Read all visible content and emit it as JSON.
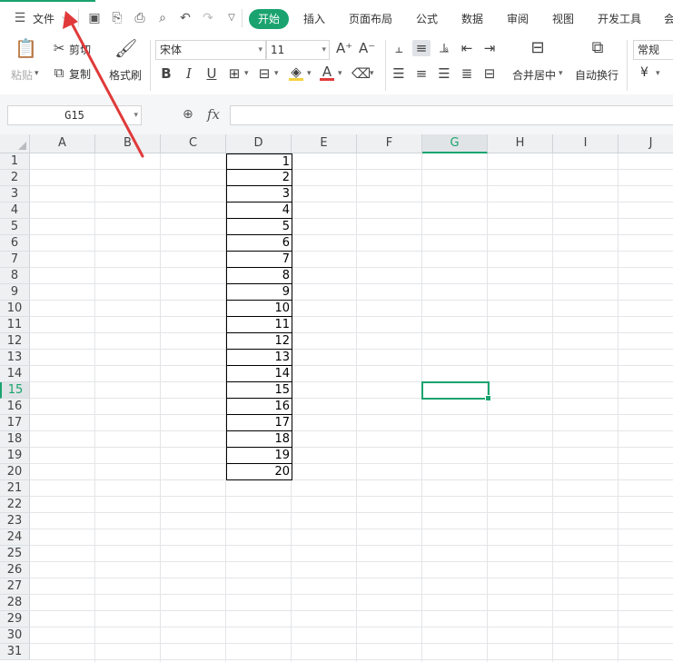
{
  "menubar": {
    "file_menu": "文件",
    "active_tab": "开始",
    "tabs": [
      "插入",
      "页面布局",
      "公式",
      "数据",
      "审阅",
      "视图",
      "开发工具",
      "会"
    ]
  },
  "ribbon": {
    "paste": "粘贴",
    "cut": "剪切",
    "copy": "复制",
    "format_painter": "格式刷",
    "font_name": "宋体",
    "font_size": "11",
    "merge_center": "合并居中",
    "wrap_text": "自动换行",
    "number_format": "常规",
    "currency_symbol": "¥"
  },
  "formula_bar": {
    "name_box": "G15",
    "fx_label": "fx",
    "formula": ""
  },
  "sheet": {
    "columns": [
      "A",
      "B",
      "C",
      "D",
      "E",
      "F",
      "G",
      "H",
      "I",
      "J"
    ],
    "selected_column": "G",
    "rows": [
      "1",
      "2",
      "3",
      "4",
      "5",
      "6",
      "7",
      "8",
      "9",
      "10",
      "11",
      "12",
      "13",
      "14",
      "15",
      "16",
      "17",
      "18",
      "19",
      "20",
      "21",
      "22",
      "23",
      "24",
      "25",
      "26",
      "27",
      "28",
      "29",
      "30",
      "31"
    ],
    "selected_row": "15",
    "selected_cell": "G15",
    "column_d_values": [
      "1",
      "2",
      "3",
      "4",
      "5",
      "6",
      "7",
      "8",
      "9",
      "10",
      "11",
      "12",
      "13",
      "14",
      "15",
      "16",
      "17",
      "18",
      "19",
      "20"
    ]
  },
  "colors": {
    "accent": "#1aa36f",
    "annotation_arrow": "#e03a3a"
  }
}
